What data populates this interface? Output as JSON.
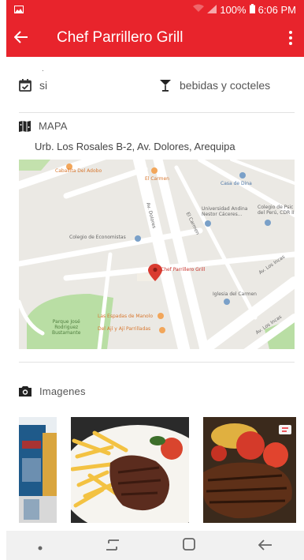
{
  "status_bar": {
    "signal_text": "100%",
    "time": "6:06 PM",
    "icons": [
      "image-icon",
      "wifi-icon",
      "signal-icon",
      "battery-icon"
    ]
  },
  "app_bar": {
    "title": "Chef Parrillero Grill",
    "back_icon": "arrow-left-icon",
    "menu_icon": "more-vert-icon"
  },
  "subtitle_mark": ".",
  "features": [
    {
      "icon": "calendar-check-icon",
      "label": "si"
    },
    {
      "icon": "cocktail-glass-icon",
      "label": "bebidas y cocteles"
    }
  ],
  "map_section": {
    "heading": "MAPA",
    "address": "Urb. Los Rosales B-2, Av. Dolores, Arequipa",
    "map_labels": {
      "caballita": "Caballita Del Adobo",
      "el_carmen_top": "El Carmen",
      "casa_de_dina": "Casa de Dina",
      "av_dolores": "Av. Dolores",
      "universidad": "Universidad Andina\nNestor Cáceres...",
      "colegio_psico": "Colegio de Psic\ndel Perú, CDR II",
      "el_carmen_road": "El Carmen",
      "colegio_eco": "Colegio de Economistas",
      "chef": "Chef Parrillero Grill",
      "av_los_incas": "Av. Los Incas",
      "iglesia": "Iglesia del Carmen",
      "parque": "Parque José\nRodriguez\nBustamante",
      "espadas": "Las Espadas de Manolo",
      "aji": "Del Ají y Ají Parrilladas",
      "av_los_incas_2": "Av. Los Incas"
    }
  },
  "images_section": {
    "heading": "Imagenes",
    "icon": "camera-icon"
  },
  "nav_bar": {
    "icons": [
      "dot-icon",
      "recent-apps-icon",
      "home-icon",
      "back-icon"
    ]
  },
  "colors": {
    "primary": "#e8242c",
    "map_bg": "#ebe9e4",
    "park": "#b9dea4",
    "road": "#ffffff",
    "pin": "#d93b30"
  }
}
